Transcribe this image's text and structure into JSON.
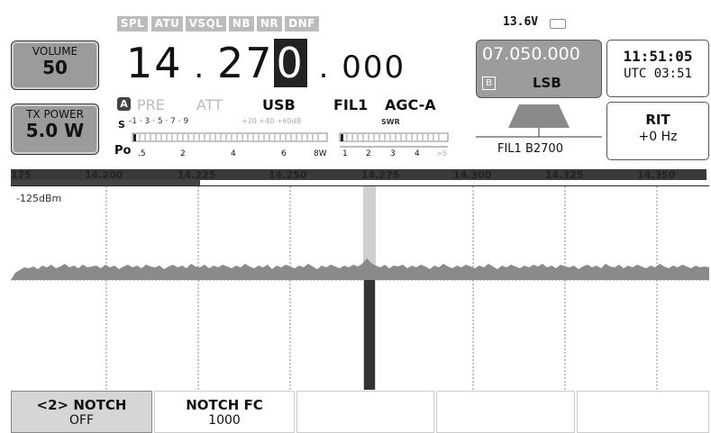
{
  "indicators": [
    "SPL",
    "ATU",
    "VSQL",
    "NB",
    "NR",
    "DNF"
  ],
  "voltage": "13.6V",
  "volume": {
    "label": "VOLUME",
    "value": "50"
  },
  "tx_power": {
    "label": "TX POWER",
    "value": "5.0 W"
  },
  "frequency": {
    "mhz": "14",
    "khz_a": "27",
    "khz_sel": "0",
    "hz": "000"
  },
  "vfo_letter": "A",
  "preamp": "PRE",
  "attenuator": "ATT",
  "mode": "USB",
  "filter": "FIL1",
  "agc": "AGC-A",
  "meter": {
    "s_label": "S",
    "s_ticks": "-1 · 3 · 5 · 7 · 9",
    "s_over": "+20  +40 +60dB",
    "swr_label": "SWR",
    "po_label": "Po",
    "po_ticks": [
      ".5",
      "2",
      "4",
      "6",
      "8W"
    ],
    "swr_ticks": [
      "1",
      "2",
      "3",
      "4",
      ">5"
    ]
  },
  "vfo_b": {
    "freq": "07.050.000",
    "letter": "B",
    "mode": "LSB"
  },
  "filter_display": "FIL1 B2700",
  "clock": {
    "local": "11:51:05",
    "utc": "UTC 03:51"
  },
  "rit": {
    "label": "RIT",
    "value": "+0 Hz"
  },
  "scale": [
    "175",
    "14.200",
    "14.225",
    "14.250",
    "14.275",
    "14.300",
    "14.325",
    "14.350"
  ],
  "ref_level": "-125dBm",
  "softkeys": [
    {
      "title": "<2> NOTCH",
      "value": "OFF"
    },
    {
      "title": "NOTCH FC",
      "value": "1000"
    },
    {
      "title": "",
      "value": ""
    },
    {
      "title": "",
      "value": ""
    },
    {
      "title": "",
      "value": ""
    }
  ]
}
